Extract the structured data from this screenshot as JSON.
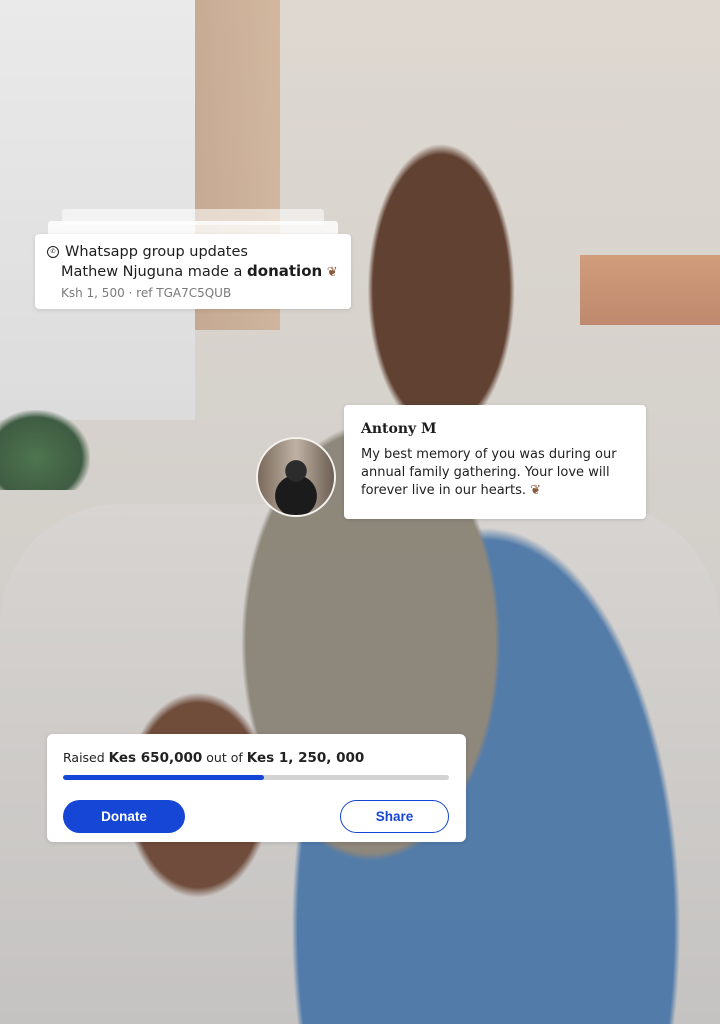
{
  "notification": {
    "app_label": "Whatsapp group updates",
    "message_prefix": "Mathew Njuguna made a",
    "message_emphasis": "donation",
    "detail": "Ksh 1, 500 · ref TGA7C5QUB",
    "icon": "whatsapp-icon"
  },
  "memory": {
    "author": "Antony M",
    "message": "My best memory of you was during our annual family gathering. Your love will forever live in our hearts.",
    "icon": "leaf-icon"
  },
  "fundraiser": {
    "raised_label": "Raised",
    "raised_amount": "Kes 650,000",
    "out_of_label": "out of",
    "goal_amount": "Kes 1, 250, 000",
    "progress_fraction": 0.52,
    "progress_color": "#1646d6",
    "donate_label": "Donate",
    "share_label": "Share"
  }
}
